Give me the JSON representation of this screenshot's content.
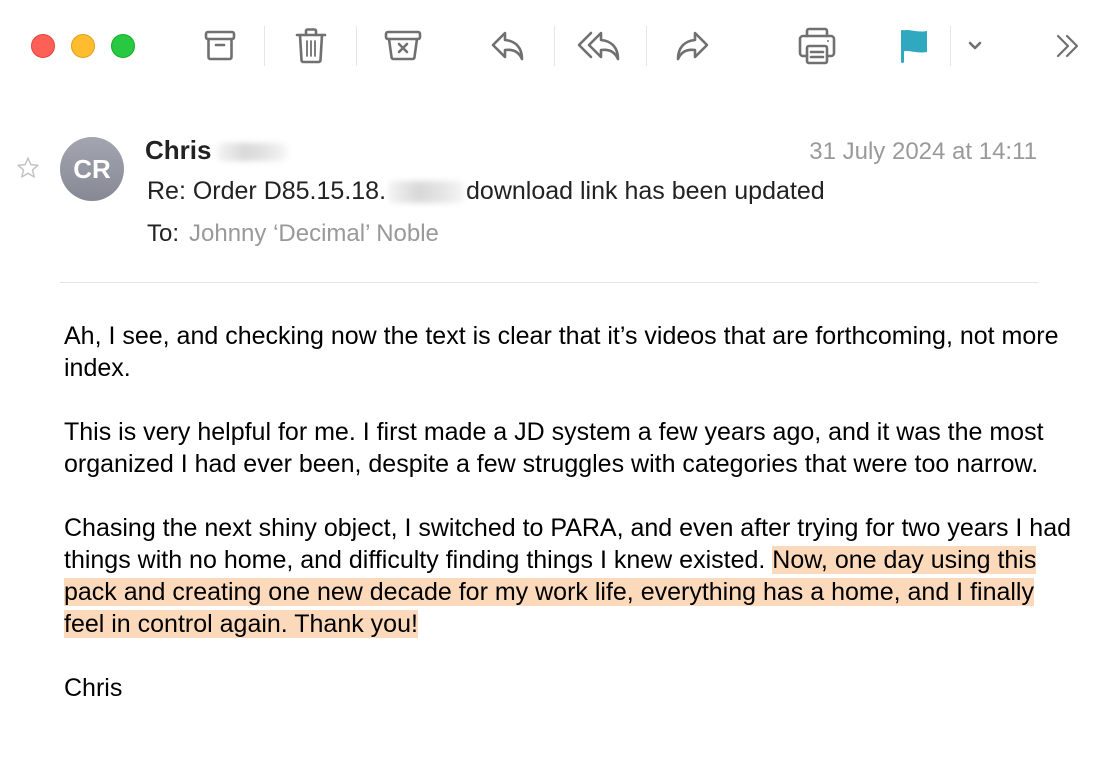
{
  "window": {
    "traffic_lights": [
      "close",
      "minimize",
      "zoom"
    ]
  },
  "toolbar": {
    "buttons": [
      {
        "name": "archive",
        "icon": "archive-box-icon"
      },
      {
        "name": "delete",
        "icon": "trash-icon"
      },
      {
        "name": "move-to-junk",
        "icon": "junk-box-icon"
      },
      {
        "name": "reply",
        "icon": "reply-icon"
      },
      {
        "name": "reply-all",
        "icon": "reply-all-icon"
      },
      {
        "name": "forward",
        "icon": "forward-icon"
      },
      {
        "name": "print",
        "icon": "printer-icon"
      },
      {
        "name": "flag",
        "icon": "flag-icon"
      },
      {
        "name": "flag-menu",
        "icon": "chevron-down-icon"
      },
      {
        "name": "more",
        "icon": "double-chevron-right-icon"
      }
    ],
    "flag_color": "#2fa8c0"
  },
  "message": {
    "starred": false,
    "avatar_initials": "CR",
    "sender_first_name": "Chris",
    "sender_last_name_redacted": true,
    "date": "31 July 2024 at 14:11",
    "subject_prefix": "Re: Order D85.15.18.",
    "subject_suffix": "download link has been updated",
    "to_label": "To:",
    "to_name": "Johnny ‘Decimal’ Noble",
    "body": {
      "p1": "Ah, I see, and checking now the text is clear that it’s videos that are forthcoming, not more index.",
      "p2": "This is very helpful for me. I first made a JD system a few years ago, and it was the most organized I had ever been, despite a few struggles with categories that were too narrow.",
      "p3_plain": "Chasing the next shiny object, I switched to PARA, and even after trying for two years I had things with no home, and difficulty finding things I knew existed.",
      "p3_highlighted": "Now, one day using this pack and creating one new decade for my work life, everything has a home, and I finally feel in control again. Thank you!",
      "signature": "Chris"
    },
    "highlight_color": "#fcd9bb"
  }
}
